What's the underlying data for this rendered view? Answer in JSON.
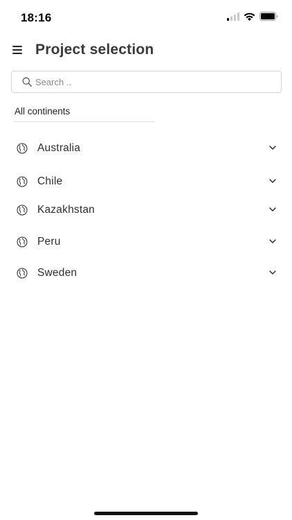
{
  "status_bar": {
    "time": "18:16",
    "icons": [
      "cellular-signal-icon",
      "wifi-icon",
      "battery-icon"
    ]
  },
  "header": {
    "menu_icon": "hamburger-menu-icon",
    "title": "Project selection"
  },
  "search": {
    "placeholder": "Search ..",
    "value": "",
    "icon": "search-icon"
  },
  "filter": {
    "label": "All continents"
  },
  "countries": [
    {
      "label": "Australia",
      "icon": "globe-icon",
      "expand_icon": "chevron-down-icon"
    },
    {
      "label": "Chile",
      "icon": "globe-icon",
      "expand_icon": "chevron-down-icon"
    },
    {
      "label": "Kazakhstan",
      "icon": "globe-icon",
      "expand_icon": "chevron-down-icon"
    },
    {
      "label": "Peru",
      "icon": "globe-icon",
      "expand_icon": "chevron-down-icon"
    },
    {
      "label": "Sweden",
      "icon": "globe-icon",
      "expand_icon": "chevron-down-icon"
    }
  ],
  "colors": {
    "text": "#262626",
    "title": "#3a3a3a",
    "border": "#d4d4d4",
    "placeholder": "#8a8a8a",
    "background": "#ffffff"
  }
}
